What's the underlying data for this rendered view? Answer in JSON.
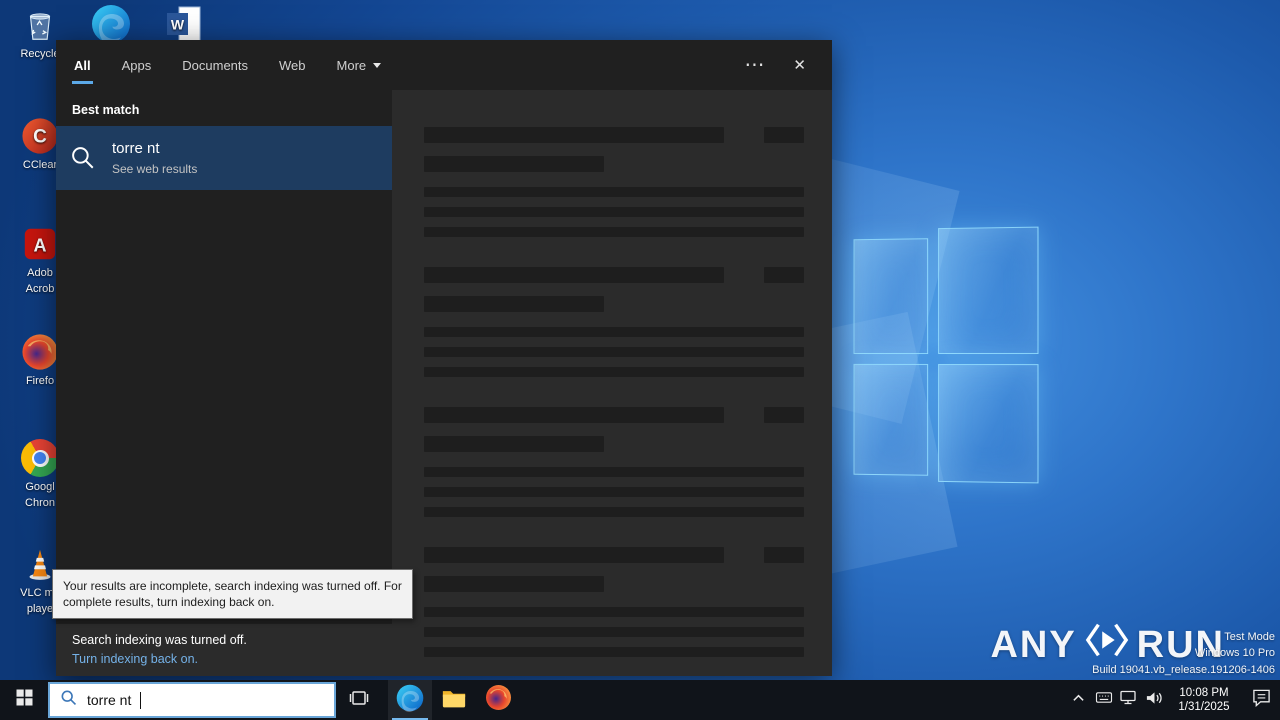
{
  "search_panel": {
    "tabs": {
      "all": "All",
      "apps": "Apps",
      "documents": "Documents",
      "web": "Web",
      "more": "More"
    },
    "header_icons": {
      "more_options": "⋯",
      "close": "✕"
    },
    "best_match_heading": "Best match",
    "result": {
      "title": "torre nt",
      "subtitle": "See web results"
    },
    "skeleton_groups": 4,
    "indexing_tooltip": "Your results are incomplete, search indexing was turned off. For complete results, turn indexing back on.",
    "indexing_notice": "Search indexing was turned off.",
    "indexing_link": "Turn indexing back on."
  },
  "desktop": {
    "icons": {
      "recycle_bin": {
        "line1": "Recycle",
        "line2": ""
      },
      "ccleaner": {
        "line1": "CClear",
        "line2": ""
      },
      "acrobat": {
        "line1": "Adob",
        "line2": "Acrob"
      },
      "firefox": {
        "line1": "Firefo",
        "line2": ""
      },
      "chrome": {
        "line1": "Googl",
        "line2": "Chron"
      },
      "vlc": {
        "line1": "VLC me",
        "line2": "playe"
      }
    }
  },
  "taskbar": {
    "search_value": "torre nt",
    "clock_time": "10:08 PM",
    "clock_date": "1/31/2025"
  },
  "watermark": {
    "brand_left": "ANY",
    "brand_right": "RUN",
    "line1": "Test Mode",
    "line2": "Windows 10 Pro",
    "line3": "Build 19041.vb_release.191206-1406"
  },
  "colors": {
    "accent_blue": "#5ca9e8",
    "selection_blue": "#1e3c60",
    "link_blue": "#75b2e8",
    "panel_dark": "#202020",
    "pane_gray": "#2b2b2b"
  }
}
